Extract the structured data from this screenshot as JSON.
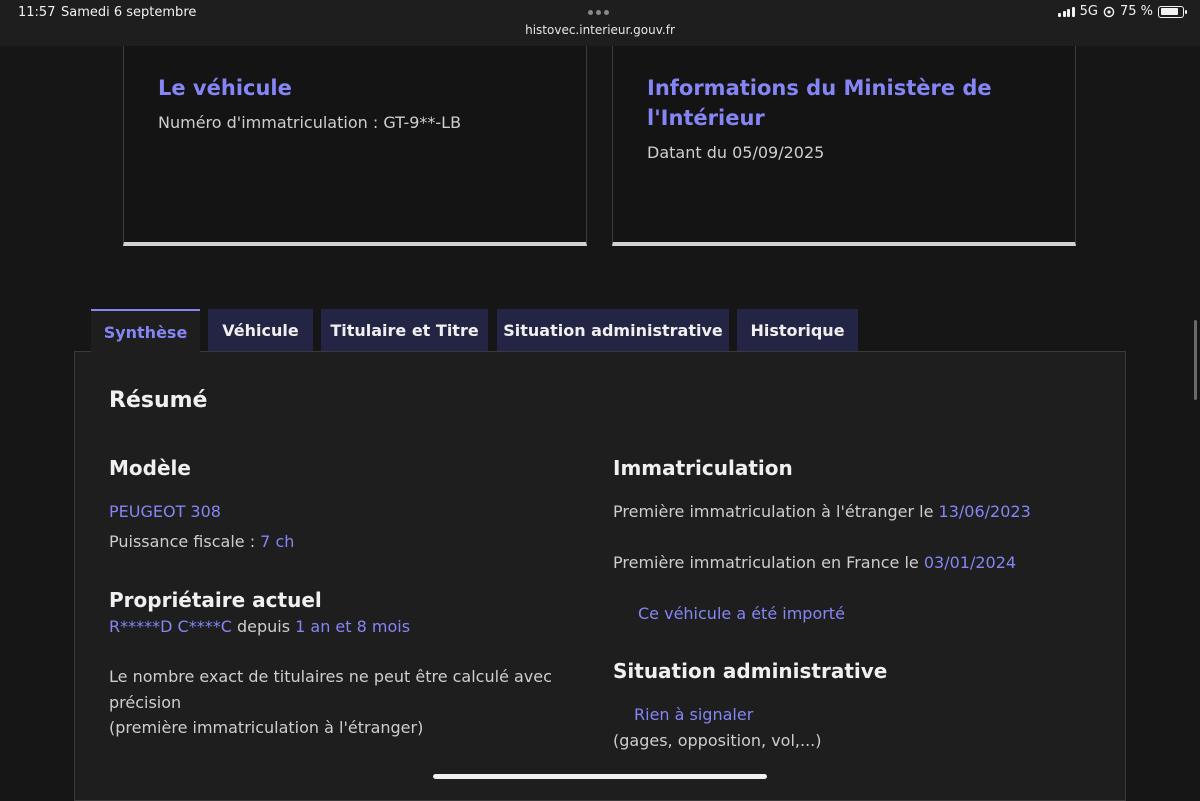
{
  "status_bar": {
    "time": "11:57",
    "date": "Samedi 6 septembre",
    "url": "histovec.interieur.gouv.fr",
    "network": "5G",
    "battery": "75 %",
    "battery_level": 0.75
  },
  "cards": {
    "vehicle": {
      "title": "Le véhicule",
      "text": "Numéro d'immatriculation : GT-9**-LB"
    },
    "ministry": {
      "title_line1": "Informations du Ministère de",
      "title_line2": "l'Intérieur",
      "text": "Datant du 05/09/2025"
    }
  },
  "tabs": [
    {
      "label": "Synthèse",
      "active": true
    },
    {
      "label": "Véhicule"
    },
    {
      "label": "Titulaire et Titre"
    },
    {
      "label": "Situation administrative"
    },
    {
      "label": "Historique"
    }
  ],
  "summary": {
    "title": "Résumé",
    "model": {
      "heading": "Modèle",
      "name": "PEUGEOT 308",
      "power_label": "Puissance fiscale : ",
      "power_value": "7 ch"
    },
    "owner": {
      "heading": "Propriétaire actuel",
      "name": "R*****D C****C",
      "since_label": " depuis ",
      "since_value": "1 an et 8 mois",
      "note_line1": "Le nombre exact de titulaires ne peut être calculé avec",
      "note_line2": "précision",
      "note_line3": "(première immatriculation à l'étranger)"
    },
    "registration": {
      "heading": "Immatriculation",
      "foreign_label": "Première immatriculation à l'étranger le ",
      "foreign_date": "13/06/2023",
      "france_label": "Première immatriculation en France le ",
      "france_date": "03/01/2024",
      "imported": "Ce véhicule a été importé"
    },
    "admin": {
      "heading": "Situation administrative",
      "status": "Rien à signaler",
      "detail": "(gages, opposition, vol,...)"
    }
  },
  "colors": {
    "accent": "#8585f6",
    "tab_bg": "#242444",
    "panel_bg": "#1e1e1e",
    "page_bg": "#161616"
  }
}
